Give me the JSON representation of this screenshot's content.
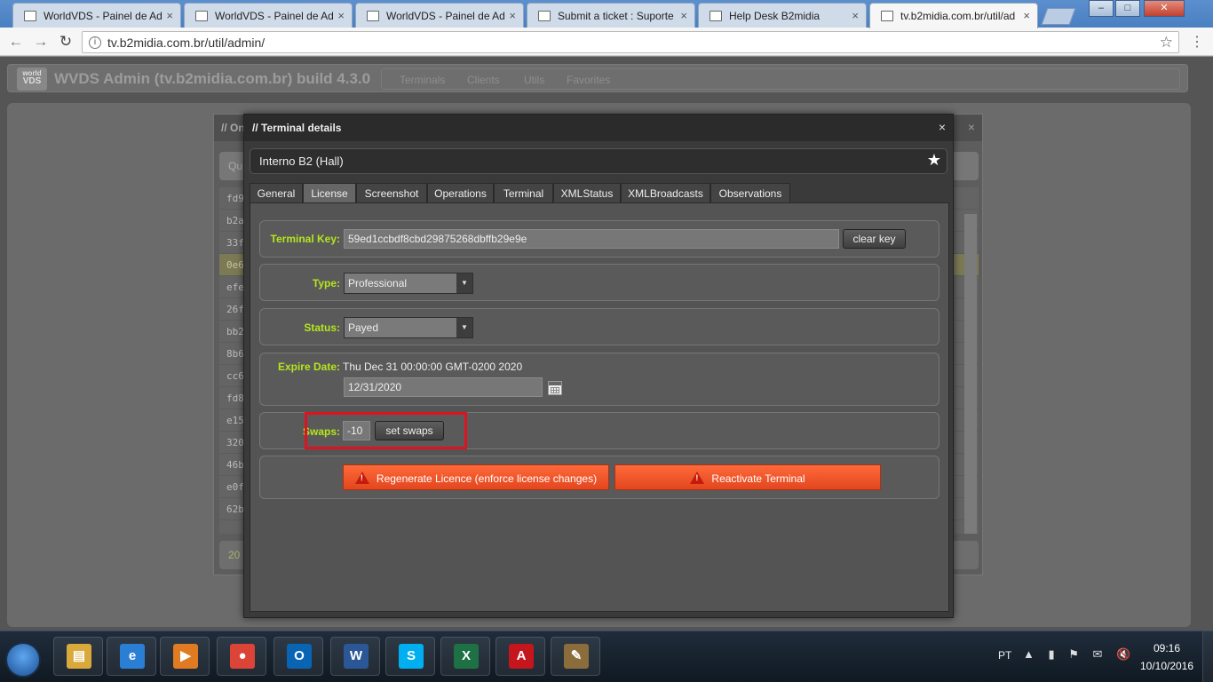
{
  "browser": {
    "tabs": [
      {
        "title": "WorldVDS - Painel de Ad",
        "active": false
      },
      {
        "title": "WorldVDS - Painel de Ad",
        "active": false
      },
      {
        "title": "WorldVDS - Painel de Ad",
        "active": false
      },
      {
        "title": "Submit a ticket : Suporte",
        "active": false
      },
      {
        "title": "Help Desk B2midia",
        "active": false
      },
      {
        "title": "tv.b2midia.com.br/util/ad",
        "active": true
      }
    ],
    "url": "tv.b2midia.com.br/util/admin/",
    "tab_close": "×",
    "window_buttons": {
      "minimize": "–",
      "maximize": "□",
      "close": "✕"
    },
    "nav": {
      "back": "←",
      "forward": "→",
      "reload": "↻",
      "info": "i",
      "bookmark": "☆",
      "menu": "⋮"
    }
  },
  "app": {
    "logo_top": "world",
    "logo_bottom": "VDS",
    "title": "WVDS Admin (tv.b2midia.com.br) build 4.3.0",
    "nav": [
      "Terminals",
      "Clients",
      "Utils",
      "Favorites"
    ]
  },
  "background_window": {
    "title": "// On",
    "close": "×",
    "search_label": "Qu",
    "rows": [
      "fd9",
      "b2a",
      "33f",
      "0e6",
      "efe",
      "26f",
      "bb2",
      "8b6",
      "cc6",
      "fd8",
      "e15",
      "320",
      "46b",
      "e0f",
      "62b"
    ],
    "selected_row": 3,
    "footer": "20"
  },
  "modal": {
    "title": "// Terminal details",
    "close": "×",
    "terminal_name": "Interno B2 (Hall)",
    "star": "★",
    "tabs": [
      "General",
      "License",
      "Screenshot",
      "Operations",
      "Terminal",
      "XMLStatus",
      "XMLBroadcasts",
      "Observations"
    ],
    "active_tab": "License",
    "license": {
      "terminal_key_label": "Terminal Key:",
      "terminal_key_value": "59ed1ccbdf8cbd29875268dbffb29e9e",
      "clear_key_label": "clear key",
      "type_label": "Type:",
      "type_value": "Professional",
      "status_label": "Status:",
      "status_value": "Payed",
      "expire_label": "Expire Date:",
      "expire_full": "Thu Dec 31 00:00:00 GMT-0200 2020",
      "expire_input": "12/31/2020",
      "swaps_label": "Swaps:",
      "swaps_value": "-10",
      "set_swaps_label": "set swaps",
      "regenerate_label": "Regenerate Licence (enforce license changes)",
      "reactivate_label": "Reactivate Terminal"
    }
  },
  "taskbar": {
    "apps": [
      {
        "name": "explorer",
        "glyph": "▤",
        "color": "#d9a93c"
      },
      {
        "name": "internet-explorer",
        "glyph": "e",
        "color": "#2a7fd5"
      },
      {
        "name": "media-player",
        "glyph": "▶",
        "color": "#e07b22"
      },
      {
        "name": "chrome",
        "glyph": "●",
        "color": "#db4437"
      },
      {
        "name": "outlook",
        "glyph": "O",
        "color": "#0a64b4"
      },
      {
        "name": "word",
        "glyph": "W",
        "color": "#2b5797"
      },
      {
        "name": "skype",
        "glyph": "S",
        "color": "#00aff0"
      },
      {
        "name": "excel",
        "glyph": "X",
        "color": "#1e7145"
      },
      {
        "name": "acrobat",
        "glyph": "A",
        "color": "#c4161c"
      },
      {
        "name": "paint",
        "glyph": "✎",
        "color": "#8a6d3b"
      }
    ],
    "language": "PT",
    "tray_icons": "▲ ▮ ⚑ ✉ 🔇",
    "time": "09:16",
    "date": "10/10/2016"
  }
}
